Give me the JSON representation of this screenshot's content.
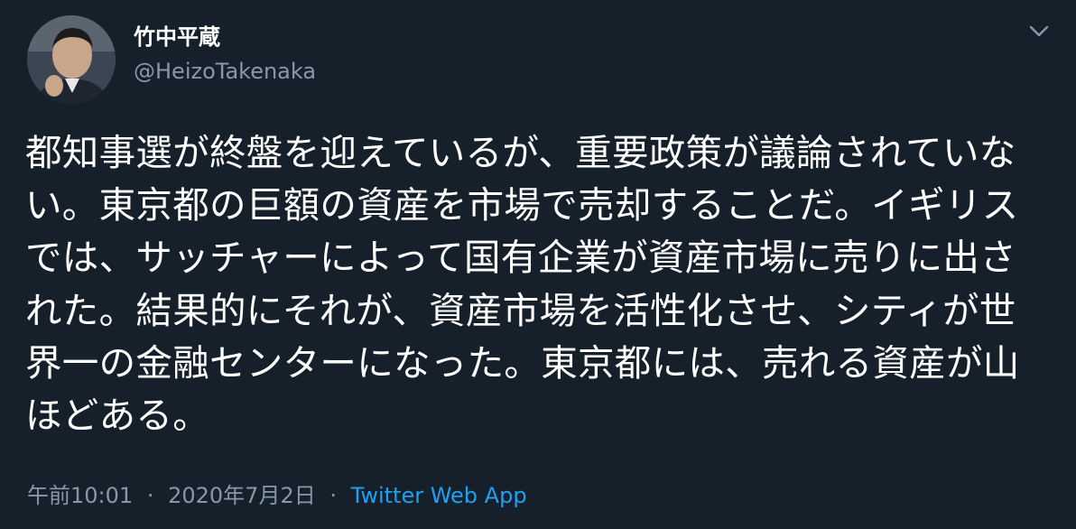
{
  "author": {
    "name": "竹中平蔵",
    "handle": "@HeizoTakenaka",
    "avatar_icon": "profile-photo"
  },
  "menu": {
    "caret_icon": "chevron-down-icon"
  },
  "tweet": {
    "text": "都知事選が終盤を迎えているが、重要政策が議論されていない。東京都の巨額の資産を市場で売却することだ。イギリスでは、サッチャーによって国有企業が資産市場に売りに出された。結果的にそれが、資産市場を活性化させ、シティが世界一の金融センターになった。東京都には、売れる資産が山ほどある。"
  },
  "meta": {
    "time": "午前10:01",
    "separator": "·",
    "date": "2020年7月2日",
    "source": "Twitter Web App"
  },
  "colors": {
    "background": "#15202b",
    "text": "#ffffff",
    "secondary": "#8899a6",
    "link": "#1da1f2"
  }
}
